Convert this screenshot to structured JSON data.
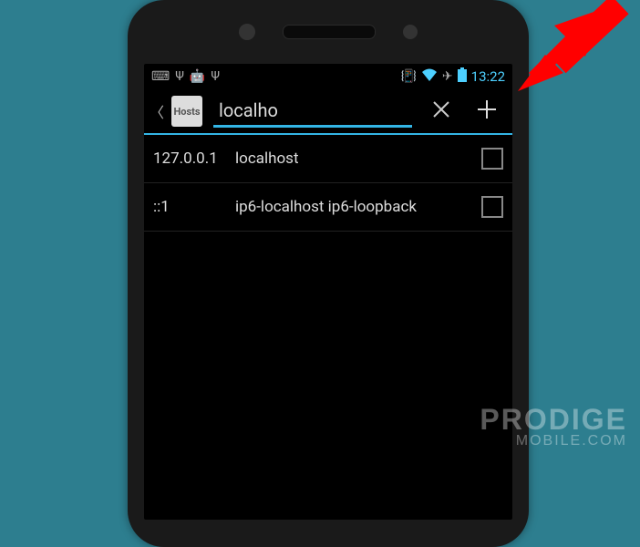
{
  "status_bar": {
    "time": "13:22",
    "left_icons": [
      "keyboard",
      "usb",
      "android",
      "usb"
    ],
    "right_icons": [
      "vibrate",
      "wifi",
      "airplane",
      "battery"
    ]
  },
  "app_bar": {
    "app_icon_label": "Hosts",
    "search_value": "localho"
  },
  "list": [
    {
      "ip": "127.0.0.1",
      "host": "localhost",
      "checked": false
    },
    {
      "ip": "::1",
      "host": "ip6-localhost ip6-loopback",
      "checked": false
    }
  ],
  "watermark": {
    "line1": "PRODIGE",
    "line2": "MOBILE.COM"
  }
}
